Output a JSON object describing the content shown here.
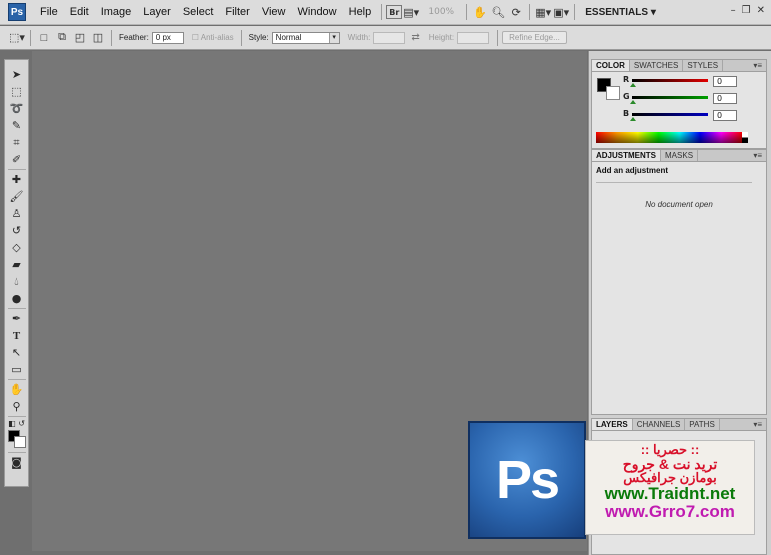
{
  "app": {
    "logo_text": "Ps"
  },
  "menu": [
    "File",
    "Edit",
    "Image",
    "Layer",
    "Select",
    "Filter",
    "View",
    "Window",
    "Help"
  ],
  "menubar_right": {
    "bridge_label": "Br",
    "zoom": "100%",
    "workspace": "ESSENTIALS"
  },
  "options": {
    "feather_label": "Feather:",
    "feather_value": "0 px",
    "antialias_label": "Anti-alias",
    "style_label": "Style:",
    "style_value": "Normal",
    "width_label": "Width:",
    "height_label": "Height:",
    "refine_edge": "Refine Edge..."
  },
  "color_panel": {
    "tabs": [
      "COLOR",
      "SWATCHES",
      "STYLES"
    ],
    "channels": [
      {
        "label": "R",
        "value": "0",
        "color": "#e00000"
      },
      {
        "label": "G",
        "value": "0",
        "color": "#00a000"
      },
      {
        "label": "B",
        "value": "0",
        "color": "#0000c0"
      }
    ]
  },
  "adjust_panel": {
    "tabs": [
      "ADJUSTMENTS",
      "MASKS"
    ],
    "title": "Add an adjustment",
    "empty_message": "No document open"
  },
  "layers_panel": {
    "tabs": [
      "LAYERS",
      "CHANNELS",
      "PATHS"
    ]
  },
  "promo": {
    "badge_text": "Ps",
    "line1": ":: حصريا ::",
    "line2": "تريد نت & جروح",
    "line3": "بومازن جرافيكس",
    "line4": "www.Traidnt.net",
    "line5": "www.Grro7.com"
  }
}
